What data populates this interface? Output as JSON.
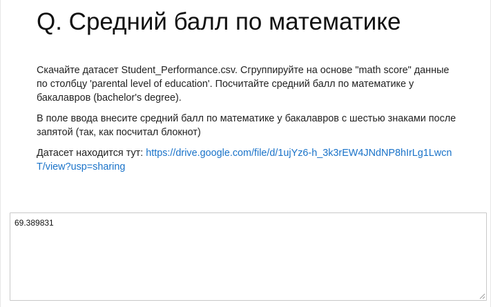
{
  "question": {
    "title": "Q. Средний балл по математике",
    "paragraph1": "Скачайте датасет Student_Performance.csv. Сгруппируйте на основе \"math score\" данные по столбцу 'parental level of education'. Посчитайте средний балл по математике у бакалавров (bachelor's degree).",
    "paragraph2": "В поле ввода внесите средний балл по математике у бакалавров с шестью знаками после запятой (так, как посчитал блокнот)",
    "dataset_prefix": "Датасет находится тут: ",
    "dataset_link_text": "https://drive.google.com/file/d/1ujYz6-h_3k3rEW4JNdNP8hIrLg1LwcnT/view?usp=sharing",
    "dataset_link_href": "https://drive.google.com/file/d/1ujYz6-h_3k3rEW4JNdNP8hIrLg1LwcnT/view?usp=sharing"
  },
  "answer": {
    "value": "69.389831"
  },
  "icons": {
    "textarea_grip": "resize-grip-icon"
  },
  "colors": {
    "link": "#1a73c9",
    "text": "#222222",
    "border": "#c8c8c8"
  }
}
